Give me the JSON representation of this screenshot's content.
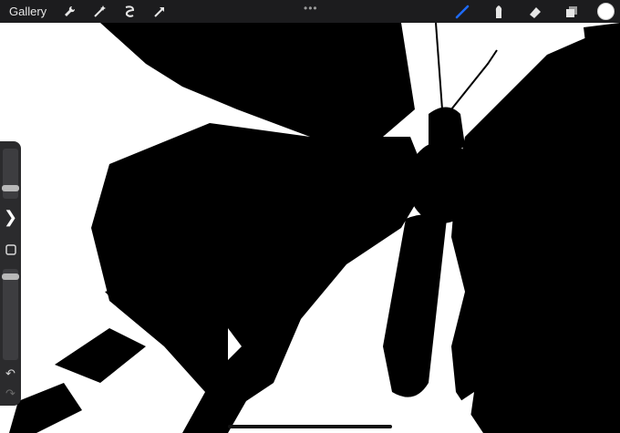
{
  "toolbar": {
    "gallery_label": "Gallery",
    "more_label": "•••",
    "left_tools": [
      "wrench-icon",
      "magic-wand-icon",
      "selection-icon",
      "transform-icon"
    ],
    "right_tools": [
      "brush-icon",
      "smudge-icon",
      "eraser-icon",
      "layers-icon"
    ],
    "active_tool": "brush-icon",
    "active_color": "#1e6bff",
    "current_color": "#ffffff"
  },
  "sidebar": {
    "size_slider_level": 0.2,
    "opacity_slider_level": 0.1,
    "undo_icon": "undo-icon",
    "redo_icon": "redo-icon"
  },
  "canvas": {
    "content": "butterfly-ink-drawing"
  }
}
